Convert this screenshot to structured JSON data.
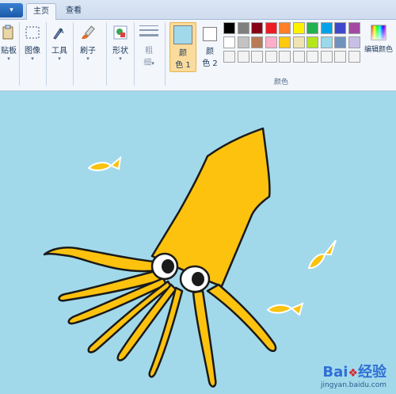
{
  "app": {
    "file_menu_glyph": "▾",
    "tabs": [
      {
        "label": "主页",
        "active": true
      },
      {
        "label": "查看",
        "active": false
      }
    ]
  },
  "ribbon": {
    "clipboard": {
      "label": "贴板",
      "icon": "clipboard-icon"
    },
    "image": {
      "label": "图像",
      "icon": "image-select-icon"
    },
    "tools": {
      "label": "工具",
      "icon": "tools-icon"
    },
    "brushes": {
      "label": "刷子",
      "icon": "brush-icon"
    },
    "shapes": {
      "label": "形状",
      "icon": "shapes-icon"
    },
    "size": {
      "label_top": "粗",
      "label_bottom": "细"
    },
    "color1": {
      "label_top": "颜",
      "label_bottom": "色 1",
      "value": "#a1d9eb"
    },
    "color2": {
      "label_top": "颜",
      "label_bottom": "色 2",
      "value": "#ffffff"
    },
    "colors_group_label": "颜色",
    "edit_colors_label": "编辑颜色",
    "palette_row1": [
      "#000000",
      "#7f7f7f",
      "#880015",
      "#ed1c24",
      "#ff7f27",
      "#fff200",
      "#22b14c",
      "#00a2e8",
      "#3f48cc",
      "#a349a4"
    ],
    "palette_row2": [
      "#ffffff",
      "#c3c3c3",
      "#b97a57",
      "#ffaec9",
      "#ffc90e",
      "#efe4b0",
      "#b5e61d",
      "#99d9ea",
      "#7092be",
      "#c8bfe7"
    ],
    "palette_row3": [
      "#f3f3f3",
      "#f3f3f3",
      "#f3f3f3",
      "#f3f3f3",
      "#f3f3f3",
      "#f3f3f3",
      "#f3f3f3",
      "#f3f3f3",
      "#f3f3f3",
      "#f3f3f3"
    ]
  },
  "canvas": {
    "background": "#a1d9eb",
    "squid_color": "#fcc20e",
    "fish_color": "#fcc20e"
  },
  "watermark": {
    "brand_left": "Bai",
    "brand_right": "经验",
    "url": "jingyan.baidu.com"
  }
}
